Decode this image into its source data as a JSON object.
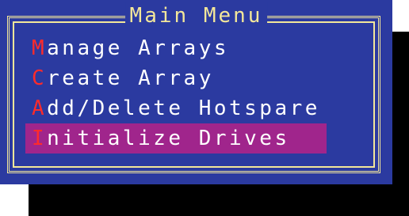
{
  "menu": {
    "title": "Main Menu",
    "items": [
      {
        "hotkey": "M",
        "rest": "anage Arrays",
        "selected": false
      },
      {
        "hotkey": "C",
        "rest": "reate Array",
        "selected": false
      },
      {
        "hotkey": "A",
        "rest": "dd/Delete Hotspare",
        "selected": false
      },
      {
        "hotkey": "I",
        "rest": "nitialize Drives",
        "selected": true
      }
    ]
  },
  "colors": {
    "background": "#2b3aa0",
    "border": "#f3e79a",
    "text": "#ffffff",
    "hotkey": "#ff2b2b",
    "selection": "#a0258c",
    "shadow": "#000000"
  }
}
